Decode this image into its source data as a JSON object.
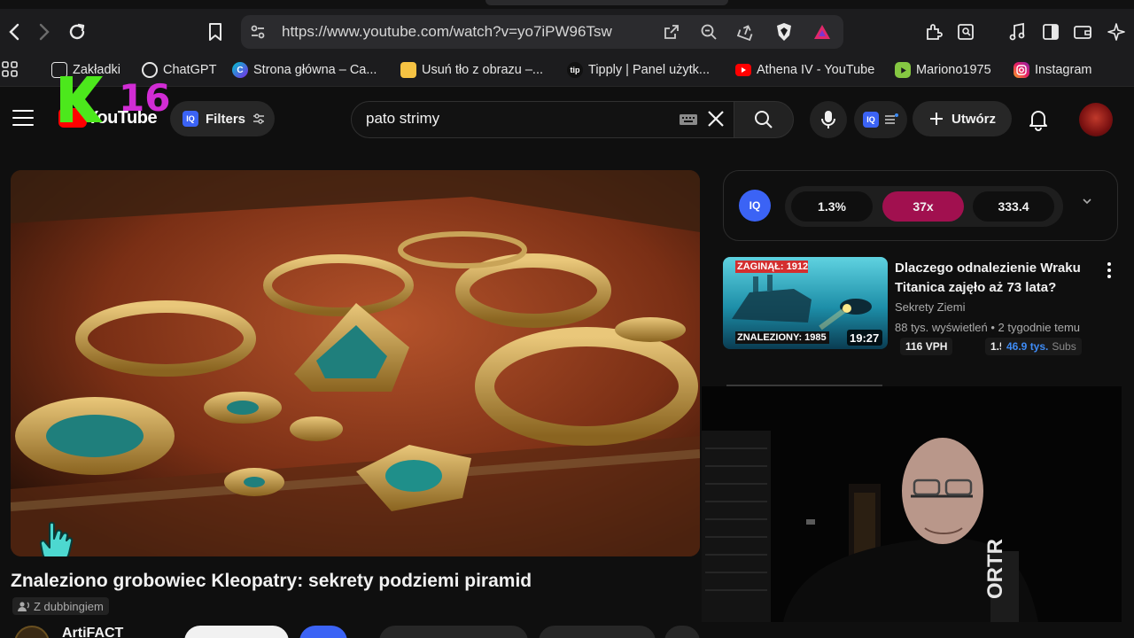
{
  "browser": {
    "url": "https://www.youtube.com/watch?v=yo7iPW96Tsw",
    "bookmarks": [
      {
        "label": "Zakładki",
        "icon": "bookmark-folder-icon"
      },
      {
        "label": "ChatGPT",
        "icon": "chatgpt-icon"
      },
      {
        "label": "Strona główna – Ca...",
        "icon": "canva-icon"
      },
      {
        "label": "Usuń tło z obrazu –...",
        "icon": "remove-bg-icon"
      },
      {
        "label": "Tipply | Panel użytk...",
        "icon": "tipply-icon"
      },
      {
        "label": "Athena IV - YouTube",
        "icon": "youtube-icon"
      },
      {
        "label": "Mariono1975",
        "icon": "rumble-icon"
      },
      {
        "label": "Instagram",
        "icon": "instagram-icon"
      }
    ],
    "tipply_glyph": "tip"
  },
  "overlay": {
    "badge_letter": "K",
    "badge_number": "16"
  },
  "youtube": {
    "logo_text": "YouTube",
    "filters_label": "Filters",
    "iq_label": "IQ",
    "search_query": "pato strimy",
    "create_label": "Utwórz"
  },
  "video": {
    "title": "Znaleziono grobowiec Kleopatry: sekrety podziemi piramid",
    "dub_label": "Z dubbingiem",
    "channel": "ArtiFACT"
  },
  "stats": {
    "values": [
      "1.3%",
      "37x",
      "333.4"
    ],
    "accent": "#a1104f"
  },
  "recommendation": {
    "title": "Dlaczego odnalezienie Wraku Titanica zajęło aż 73 lata?",
    "channel": "Sekrety Ziemi",
    "meta": "88 tys. wyświetleń • 2 tygodnie temu",
    "duration": "19:27",
    "thumb_top_text": "ZAGINĄŁ: 1912",
    "thumb_bottom_text": "ZNALEZIONY: 1985",
    "tags": {
      "vph": "116 VPH",
      "ratio": "1.5x",
      "subs_value": "46.9 tys.",
      "subs_label": "Subs"
    }
  },
  "webcam": {
    "shirt_text": "ORTR"
  },
  "colors": {
    "youtube_red": "#ff0000",
    "iq_blue": "#3b63f5",
    "badge_green": "#4ce81c",
    "badge_magenta": "#d12cd4"
  }
}
